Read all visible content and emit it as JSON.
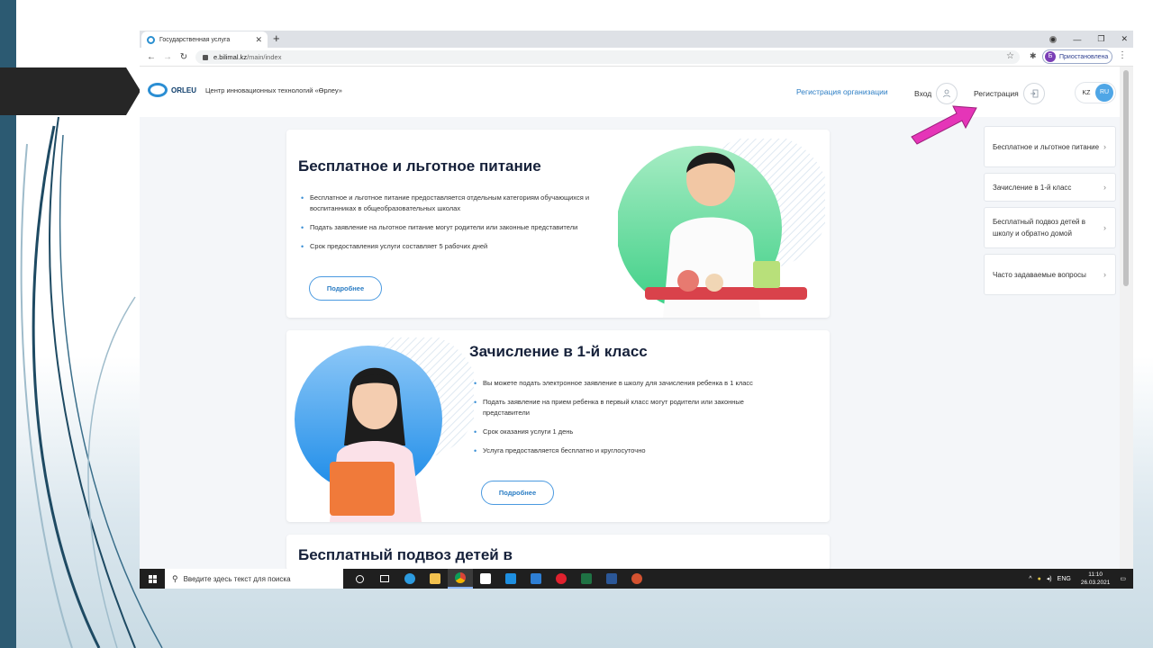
{
  "browser": {
    "tab_title": "Государственная услуга",
    "url_host": "e.bilimal.kz",
    "url_path": "/main/index",
    "profile_initial": "Б",
    "profile_status": "Приостановлена"
  },
  "header": {
    "brand": "ORLEU",
    "subtitle": "Центр инновационных технологий «Өрлеу»",
    "reg_org": "Регистрация организации",
    "login": "Вход",
    "register": "Регистрация",
    "lang_kz": "KZ",
    "lang_ru": "RU"
  },
  "cards": [
    {
      "title": "Бесплатное и льготное питание",
      "bullets": [
        "Бесплатное и льготное питание предоставляется отдельным категориям обучающихся и воспитанниках в общеобразовательных школах",
        "Подать заявление на льготное питание могут родители или законные представители",
        "Срок предоставления услуги составляет 5 рабочих дней"
      ],
      "more": "Подробнее"
    },
    {
      "title": "Зачисление в 1-й класс",
      "bullets": [
        "Вы можете подать электронное заявление в школу для зачисления ребенка в 1 класс",
        "Подать заявление на прием ребенка в первый класс могут родители или законные представители",
        "Срок оказания услуги 1 день",
        "Услуга предоставляется бесплатно и круглосуточно"
      ],
      "more": "Подробнее"
    },
    {
      "title": "Бесплатный подвоз детей в"
    }
  ],
  "sidebar": {
    "items": [
      {
        "label": "Бесплатное и льготное питание"
      },
      {
        "label": "Зачисление в 1-й класс"
      },
      {
        "label": "Бесплатный подвоз детей в школу и обратно домой"
      },
      {
        "label": "Часто задаваемые вопросы"
      }
    ]
  },
  "taskbar": {
    "search_placeholder": "Введите здесь текст для поиска",
    "lang": "ENG",
    "time": "11:10",
    "date": "26.03.2021"
  },
  "colors": {
    "accent": "#2b7dc4",
    "arrow": "#e535b8",
    "slide_strip": "#2c5a72"
  }
}
